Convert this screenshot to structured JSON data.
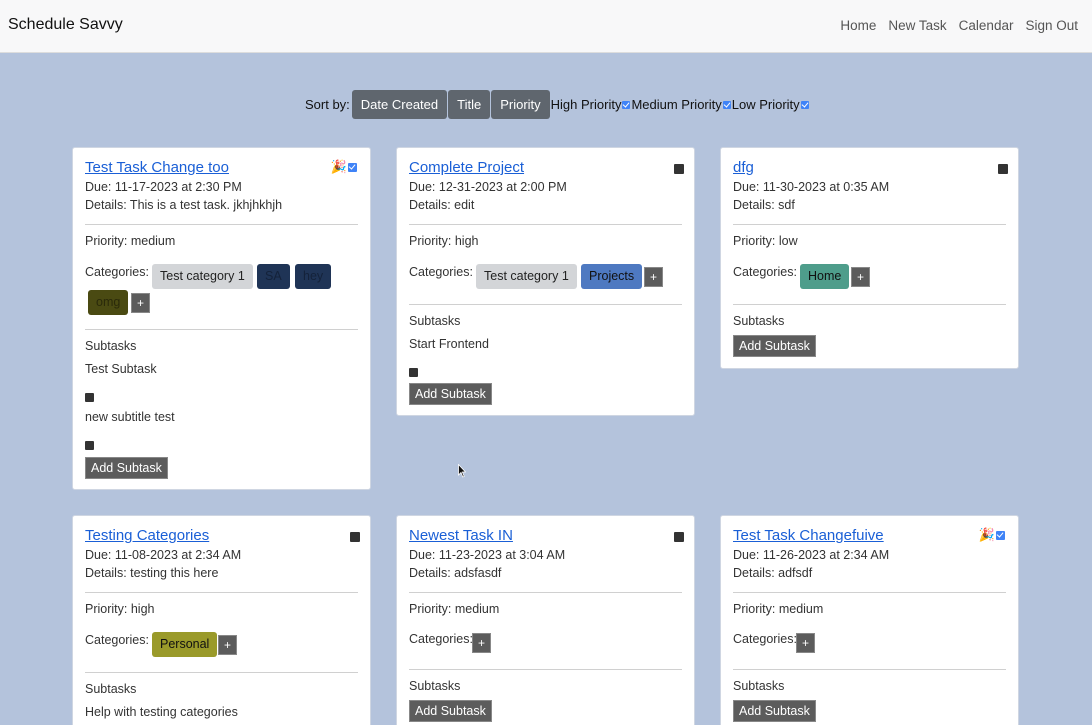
{
  "app": {
    "title": "Schedule Savvy"
  },
  "nav": {
    "home": "Home",
    "new_task": "New Task",
    "calendar": "Calendar",
    "sign_out": "Sign Out"
  },
  "sort": {
    "label": "Sort by:",
    "buttons": [
      "Date Created",
      "Title",
      "Priority"
    ],
    "filters": [
      {
        "label": "High Priority",
        "checked": true
      },
      {
        "label": "Medium Priority",
        "checked": true
      },
      {
        "label": "Low Priority",
        "checked": true
      }
    ]
  },
  "colors": {
    "page_bg": "#b4c3dc",
    "link": "#1a5fd6",
    "button": "#5f666e",
    "cat_gray": "#d3d5d8",
    "cat_navy": "#1f3456",
    "cat_olive": "#4a4a12",
    "cat_blue": "#4e79c1",
    "cat_teal": "#4e9d8b",
    "cat_yellow": "#9a9a2a",
    "check": "#3f83f7"
  },
  "labels": {
    "priority_prefix": "Priority: ",
    "categories": "Categories:",
    "subtasks": "Subtasks",
    "add_subtask": "Add Subtask",
    "plus": "+",
    "completed_icon": "🎉"
  },
  "tasks": [
    {
      "title": "Test Task Change too",
      "due": "Due: 11-17-2023 at 2:30 PM",
      "details": "Details: This is a test task. jkhjhkhjh",
      "priority": "Priority: medium",
      "completed": true,
      "categories": [
        {
          "name": "Test category 1",
          "color": "#d3d5d8"
        },
        {
          "name": "SA",
          "color": "#1f3456"
        },
        {
          "name": "hey",
          "color": "#1f3456"
        },
        {
          "name": "omg",
          "color": "#4a4a12"
        }
      ],
      "subtasks": [
        "Test Subtask",
        "new subtitle test"
      ]
    },
    {
      "title": "Complete Project",
      "due": "Due: 12-31-2023 at 2:00 PM",
      "details": "Details: edit",
      "priority": "Priority: high",
      "completed": false,
      "categories": [
        {
          "name": "Test category 1",
          "color": "#d3d5d8"
        },
        {
          "name": "Projects",
          "color": "#4e79c1"
        }
      ],
      "subtasks": [
        "Start Frontend"
      ]
    },
    {
      "title": "dfg",
      "due": "Due: 11-30-2023 at 0:35 AM",
      "details": "Details: sdf",
      "priority": "Priority: low",
      "completed": false,
      "categories": [
        {
          "name": "Home",
          "color": "#4e9d8b"
        }
      ],
      "subtasks": []
    },
    {
      "title": "Testing Categories",
      "due": "Due: 11-08-2023 at 2:34 AM",
      "details": "Details: testing this here",
      "priority": "Priority: high",
      "completed": false,
      "categories": [
        {
          "name": "Personal",
          "color": "#9a9a2a"
        }
      ],
      "subtasks": [
        "Help with testing categories"
      ]
    },
    {
      "title": "Newest Task IN",
      "due": "Due: 11-23-2023 at 3:04 AM",
      "details": "Details: adsfasdf",
      "priority": "Priority: medium",
      "completed": false,
      "categories": [],
      "subtasks": []
    },
    {
      "title": "Test Task Changefuive",
      "due": "Due: 11-26-2023 at 2:34 AM",
      "details": "Details: adfsdf",
      "priority": "Priority: medium",
      "completed": true,
      "categories": [],
      "subtasks": []
    }
  ]
}
